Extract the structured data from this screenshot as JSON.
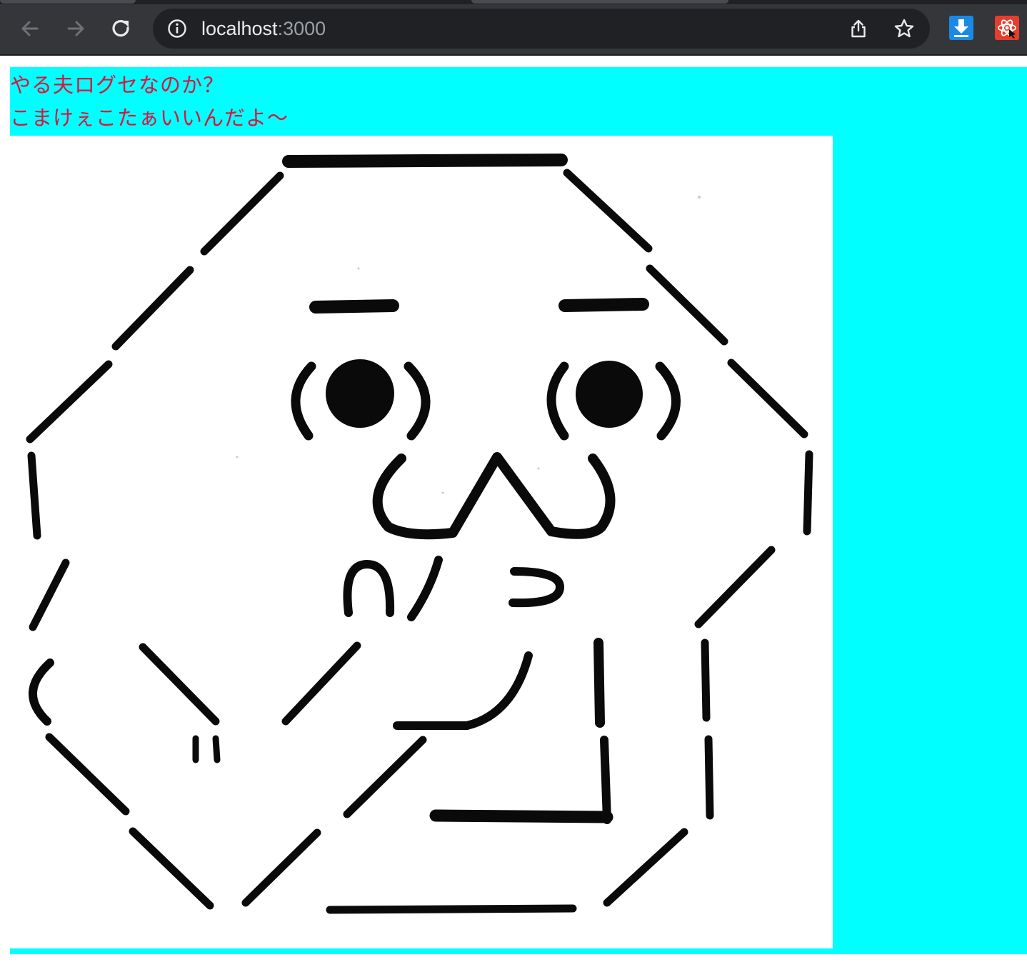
{
  "browser": {
    "url_host": "localhost",
    "url_port": ":3000",
    "icons": {
      "back": "arrow-left-icon",
      "forward": "arrow-right-icon",
      "reload": "reload-icon",
      "site_info": "info-icon",
      "share": "share-icon",
      "bookmark": "star-icon",
      "extension_1": "download-icon",
      "extension_2": "react-devtools-icon"
    },
    "colors": {
      "toolbar": "#35363a",
      "omnibox": "#202124",
      "url_text": "#e8eaed",
      "url_port": "#9aa0a6"
    }
  },
  "page": {
    "background": "#00ffff",
    "text_color": "#dc143c",
    "lines": [
      "やる夫ログセなのか？",
      "こまけぇこたぁいいんだよ〜"
    ],
    "image": {
      "subject": "ascii-art-face",
      "background": "#ffffff"
    }
  }
}
